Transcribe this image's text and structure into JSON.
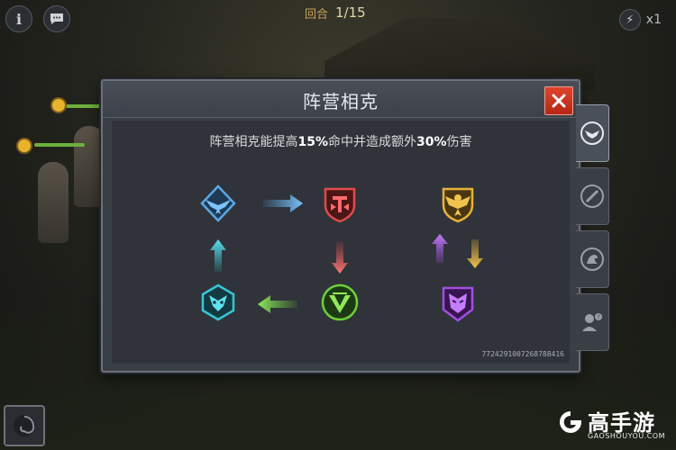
{
  "hud": {
    "info_label": "i",
    "round_label": "回合",
    "round_value": "1/15",
    "speed_label": "x1"
  },
  "dialog": {
    "title": "阵营相克",
    "desc_prefix": "阵营相克能提高",
    "desc_hit": "15%",
    "desc_mid": "命中并造成额外",
    "desc_dmg": "30%",
    "desc_suffix": "伤害",
    "code": "772429100726878841​6"
  },
  "factions": [
    {
      "name": "blue-wing-faction",
      "color": "#5aa8e6"
    },
    {
      "name": "red-shield-faction",
      "color": "#e04a4a"
    },
    {
      "name": "green-faction",
      "color": "#6fcf3a"
    },
    {
      "name": "cyan-faction",
      "color": "#38c6d6"
    },
    {
      "name": "gold-faction",
      "color": "#e8b23a"
    },
    {
      "name": "purple-faction",
      "color": "#a24fe0"
    }
  ],
  "side_tabs": [
    "faction-tab",
    "skill-tab",
    "strength-tab",
    "help-tab"
  ],
  "watermark": {
    "brand": "高手游",
    "site": "GAOSHOUYOU.COM"
  }
}
